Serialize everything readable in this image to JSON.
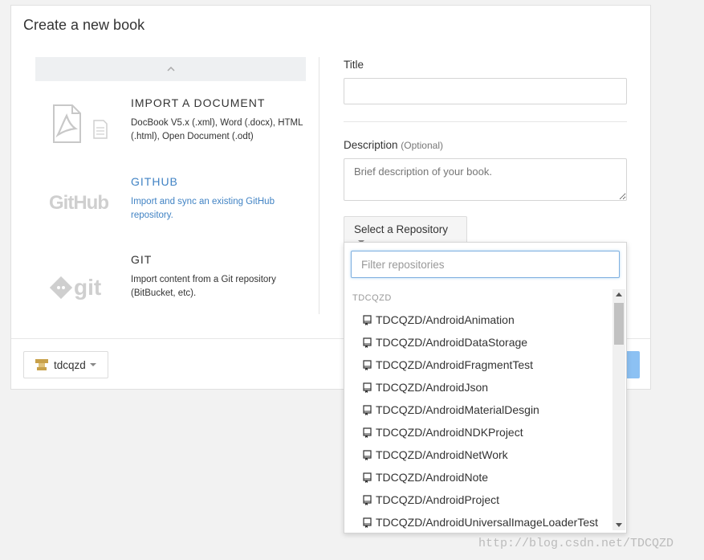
{
  "modal": {
    "title": "Create a new book"
  },
  "import_options": [
    {
      "title": "IMPORT A DOCUMENT",
      "description": "DocBook V5.x (.xml), Word (.docx), HTML (.html), Open Document (.odt)",
      "icon": "pdf-document-icon"
    },
    {
      "title": "GITHUB",
      "description": "Import and sync an existing GitHub repository.",
      "icon": "github-logo-icon"
    },
    {
      "title": "GIT",
      "description": "Import content from a Git repository (BitBucket, etc).",
      "icon": "git-logo-icon"
    }
  ],
  "form": {
    "title_label": "Title",
    "title_value": "",
    "description_label": "Description",
    "description_optional": "(Optional)",
    "description_placeholder": "Brief description of your book.",
    "repo_button_label": "Select a Repository"
  },
  "dropdown": {
    "filter_placeholder": "Filter repositories",
    "group_label": "TDCQZD",
    "repos": [
      "TDCQZD/AndroidAnimation",
      "TDCQZD/AndroidDataStorage",
      "TDCQZD/AndroidFragmentTest",
      "TDCQZD/AndroidJson",
      "TDCQZD/AndroidMaterialDesgin",
      "TDCQZD/AndroidNDKProject",
      "TDCQZD/AndroidNetWork",
      "TDCQZD/AndroidNote",
      "TDCQZD/AndroidProject",
      "TDCQZD/AndroidUniversalImageLoaderTest"
    ]
  },
  "footer": {
    "account_label": "tdcqzd"
  },
  "watermark": "http://blog.csdn.net/TDCQZD",
  "colors": {
    "link_blue": "#4183c4",
    "focus_border": "#7fb0e0",
    "primary_button": "#8cc1f3"
  }
}
